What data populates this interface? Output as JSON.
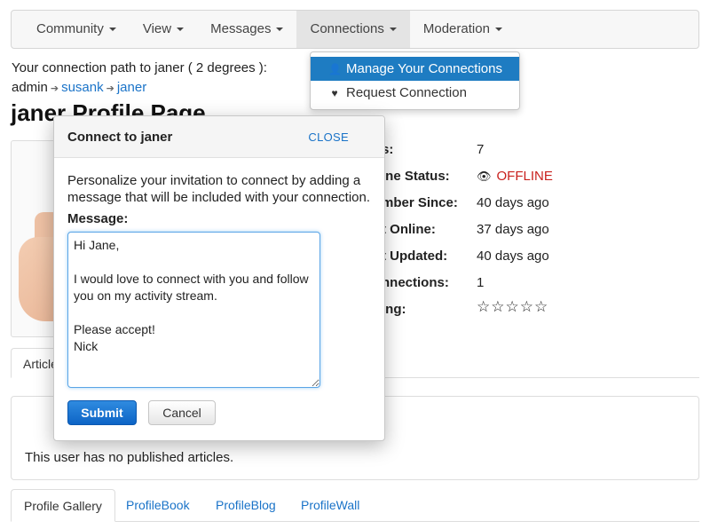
{
  "navbar": {
    "items": [
      {
        "label": "Community"
      },
      {
        "label": "View"
      },
      {
        "label": "Messages"
      },
      {
        "label": "Connections"
      },
      {
        "label": "Moderation"
      }
    ]
  },
  "dropdown": {
    "items": [
      {
        "label": "Manage Your Connections",
        "icon": "person-icon"
      },
      {
        "label": "Request Connection",
        "icon": "heart-icon"
      }
    ]
  },
  "profile": {
    "path_text": "Your connection path to janer ( 2 degrees ):",
    "breadcrumb": [
      "admin",
      "susank",
      "janer"
    ],
    "page_title": "janer Profile Page",
    "info": [
      {
        "label": "s:",
        "value": "7"
      },
      {
        "label": "ine Status:",
        "value": "OFFLINE",
        "icon": "eye-slash-icon",
        "color": "#c9211e"
      },
      {
        "label": "mber Since:",
        "value": "40 days ago"
      },
      {
        "label": "t Online:",
        "value": "37 days ago"
      },
      {
        "label": "t Updated:",
        "value": "40 days ago"
      },
      {
        "label": "nnections:",
        "value": "1"
      },
      {
        "label": "ing:",
        "value": "☆☆☆☆☆"
      }
    ],
    "tab_top": "Articles",
    "no_articles": "This user has no published articles.",
    "bottom_tabs": [
      "Profile Gallery",
      "ProfileBook",
      "ProfileBlog",
      "ProfileWall"
    ]
  },
  "modal": {
    "title": "Connect to janer",
    "close_label": "CLOSE",
    "description": "Personalize your invitation to connect by adding a message that will be included with your connection.",
    "message_label": "Message:",
    "message_value": "Hi Jane,\n\nI would love to connect with you and follow you on my activity stream.\n\nPlease accept!\nNick",
    "submit_label": "Submit",
    "cancel_label": "Cancel"
  },
  "colors": {
    "accent": "#1e7cc2",
    "link": "#1a73c8",
    "offline": "#c9211e"
  }
}
